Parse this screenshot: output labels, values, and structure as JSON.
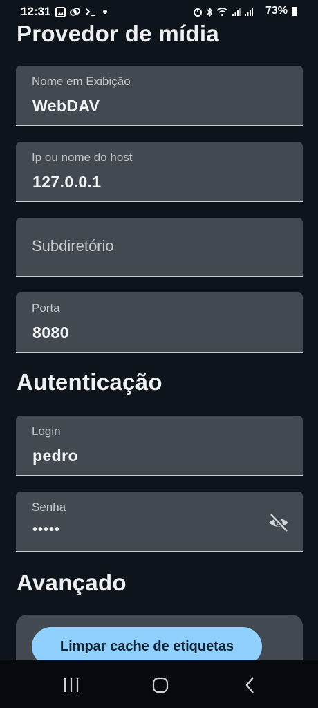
{
  "status_bar": {
    "time": "12:31",
    "battery": "73%",
    "left_icons": [
      "image-icon",
      "cloud-icon",
      "terminal-icon",
      "dot-icon"
    ],
    "right_icons": [
      "alarm-icon",
      "bluetooth-icon",
      "wifi-icon",
      "signal-icon",
      "signal-icon",
      "battery-icon"
    ]
  },
  "sections": {
    "media_provider_title": "Provedor de mídia",
    "auth_title": "Autenticação",
    "advanced_title": "Avançado"
  },
  "fields": {
    "display_name": {
      "label": "Nome em Exibição",
      "value": "WebDAV"
    },
    "host": {
      "label": "Ip ou nome do host",
      "value": "127.0.0.1"
    },
    "subdirectory": {
      "placeholder": "Subdiretório"
    },
    "port": {
      "label": "Porta",
      "value": "8080"
    },
    "login": {
      "label": "Login",
      "value": "pedro"
    },
    "password": {
      "label": "Senha",
      "value": "•••••",
      "toggle_icon": "eye-off-icon"
    }
  },
  "advanced": {
    "clear_cache_label": "Limpar cache de etiquetas"
  },
  "nav_bar": {
    "buttons": [
      "recent-apps-icon",
      "home-icon",
      "back-icon"
    ]
  },
  "colors": {
    "background": "#0d141b",
    "field_bg": "#424951",
    "accent_button": "#8fd0ff"
  }
}
